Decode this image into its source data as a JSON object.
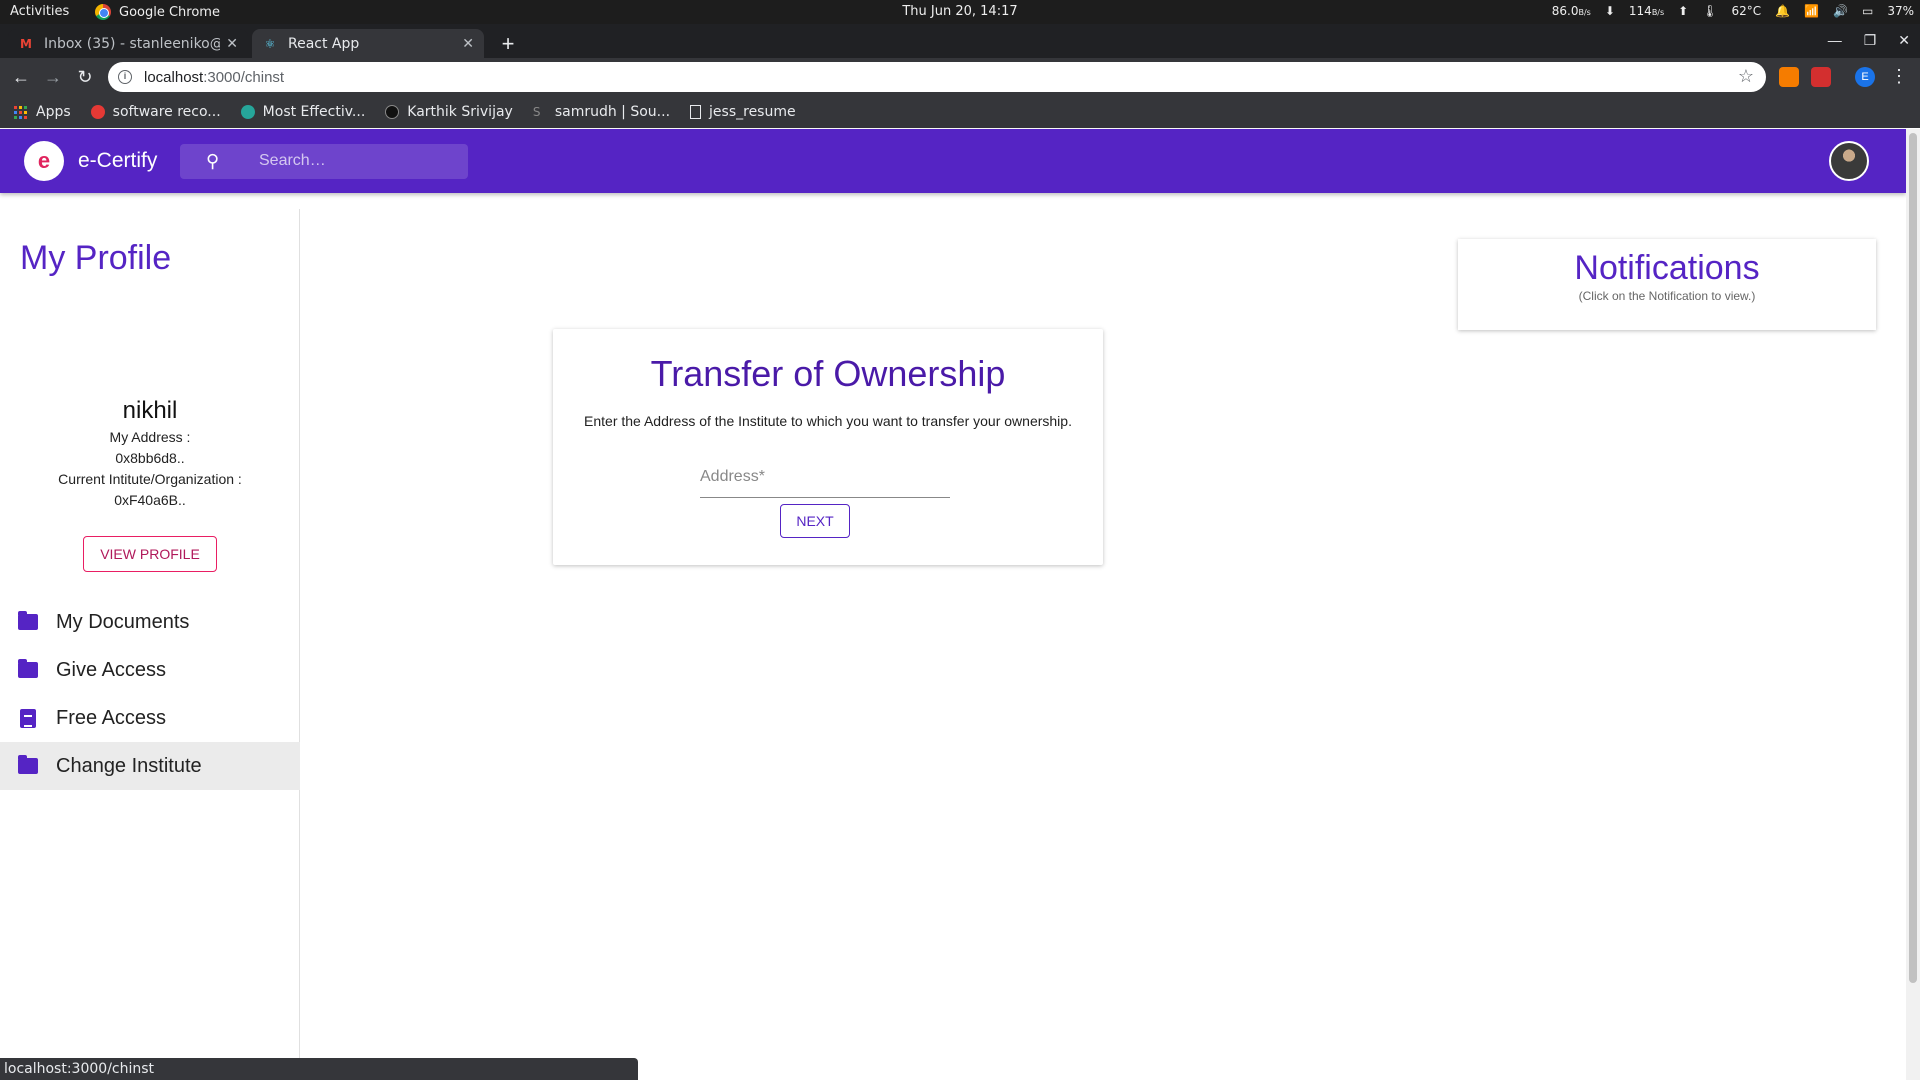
{
  "os": {
    "activities": "Activities",
    "app_name": "Google Chrome",
    "clock": "Thu Jun 20, 14:17",
    "net_down": "86.0",
    "net_down_unit": "B/s",
    "net_up": "114",
    "net_up_unit": "B/s",
    "temp": "62°C",
    "battery": "37%"
  },
  "browser": {
    "tabs": [
      {
        "title": "Inbox (35) - stanleeniko@",
        "icon": "gmail-icon"
      },
      {
        "title": "React App",
        "icon": "react-icon"
      }
    ],
    "url_host": "localhost",
    "url_path": ":3000/chinst",
    "bookmarks": [
      {
        "label": "Apps",
        "icon": "apps-grid-icon"
      },
      {
        "label": "software reco...",
        "icon": "ask-icon"
      },
      {
        "label": "Most Effectiv...",
        "icon": "globe-icon"
      },
      {
        "label": "Karthik Srivijay",
        "icon": "github-icon"
      },
      {
        "label": "samrudh | Sou...",
        "icon": "soundcloud-icon"
      },
      {
        "label": "jess_resume",
        "icon": "document-icon"
      }
    ],
    "profile_initial": "E",
    "status_url": "localhost:3000/chinst"
  },
  "appbar": {
    "logo_glyph": "e",
    "title": "e-Certify",
    "search_placeholder": "Search…"
  },
  "sidebar": {
    "title": "My Profile",
    "username": "nikhil",
    "address_label": "My Address :",
    "address_value": "0x8bb6d8..",
    "institute_label": "Current Intitute/Organization :",
    "institute_value": "0xF40a6B..",
    "view_profile": "VIEW PROFILE",
    "nav": [
      {
        "label": "My Documents",
        "icon": "folder-icon"
      },
      {
        "label": "Give Access",
        "icon": "folder-icon"
      },
      {
        "label": "Free Access",
        "icon": "clipboard-icon"
      },
      {
        "label": "Change Institute",
        "icon": "folder-icon",
        "active": true
      }
    ]
  },
  "transfer": {
    "title": "Transfer of Ownership",
    "description": "Enter the Address of the Institute to which you want to transfer your ownership.",
    "address_placeholder": "Address*",
    "next_label": "NEXT"
  },
  "notifications": {
    "title": "Notifications",
    "subtitle": "(Click on the Notification to view.)"
  },
  "colors": {
    "primary": "#5524c4",
    "accent_pink": "#e91e63"
  }
}
